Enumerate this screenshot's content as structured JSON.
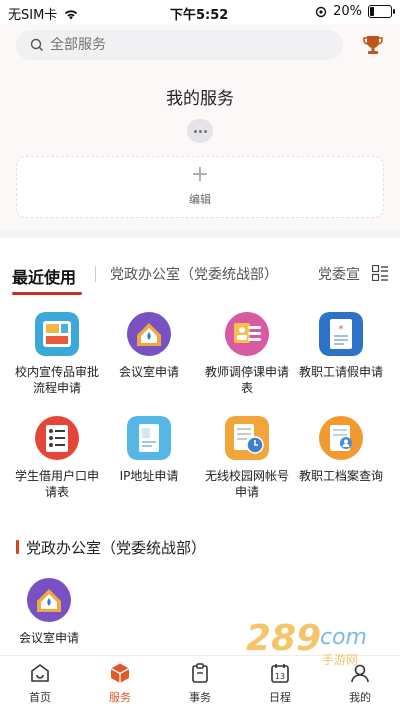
{
  "status_bar": {
    "carrier": "无SIM卡",
    "time": "下午5:52",
    "battery": "20%",
    "battery_level": 0.2
  },
  "search": {
    "placeholder": "全部服务"
  },
  "my_services": {
    "title": "我的服务",
    "edit_label": "编辑"
  },
  "tabs": [
    {
      "label": "最近使用",
      "active": true
    },
    {
      "label": "党政办公室（党委统战部）",
      "active": false
    },
    {
      "label": "党委宣",
      "active": false
    }
  ],
  "recent_apps": [
    {
      "label": "校内宣传品审批流程申请",
      "icon": "poster-icon"
    },
    {
      "label": "会议室申请",
      "icon": "meeting-room-icon"
    },
    {
      "label": "教师调停课申请表",
      "icon": "teacher-schedule-icon"
    },
    {
      "label": "教职工请假申请",
      "icon": "leave-request-icon"
    },
    {
      "label": "学生借用户口申请表",
      "icon": "student-residence-icon"
    },
    {
      "label": "IP地址申请",
      "icon": "ip-address-icon"
    },
    {
      "label": "无线校园网帐号申请",
      "icon": "wireless-account-icon"
    },
    {
      "label": "教职工档案查询",
      "icon": "staff-archive-icon"
    }
  ],
  "section": {
    "title": "党政办公室（党委统战部）",
    "apps": [
      {
        "label": "会议室申请",
        "icon": "meeting-room-icon"
      }
    ]
  },
  "bottom_nav": [
    {
      "label": "首页",
      "icon": "home-icon",
      "active": false
    },
    {
      "label": "服务",
      "icon": "service-cube-icon",
      "active": true
    },
    {
      "label": "事务",
      "icon": "clipboard-icon",
      "active": false
    },
    {
      "label": "日程",
      "icon": "calendar-icon",
      "active": false,
      "badge": "13"
    },
    {
      "label": "我的",
      "icon": "profile-icon",
      "active": false
    }
  ],
  "colors": {
    "accent": "#e0572a",
    "tab_underline": "#c4321d",
    "section_bar": "#d6411f"
  }
}
